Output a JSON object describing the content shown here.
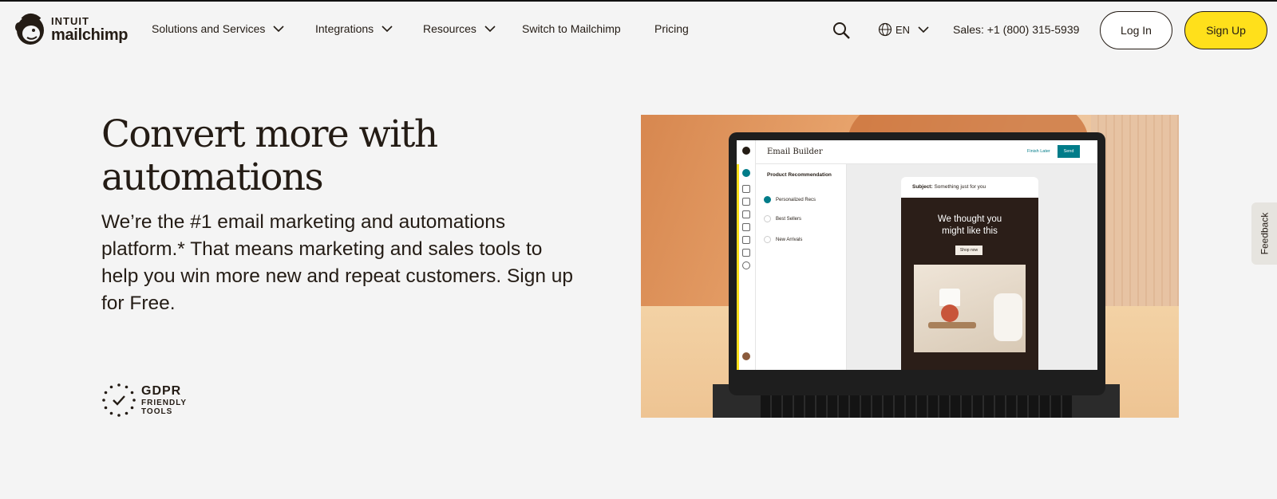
{
  "nav": {
    "logo": {
      "brand_top": "INTUIT",
      "brand_main": "mailchimp",
      "icon": "freddie-logo-icon"
    },
    "items": [
      {
        "label": "Solutions and Services",
        "has_dropdown": true
      },
      {
        "label": "Integrations",
        "has_dropdown": true
      },
      {
        "label": "Resources",
        "has_dropdown": true
      },
      {
        "label": "Switch to Mailchimp",
        "has_dropdown": false
      },
      {
        "label": "Pricing",
        "has_dropdown": false
      }
    ],
    "search_icon": "search-icon",
    "language": {
      "icon": "globe-icon",
      "label": "EN"
    },
    "sales": "Sales: +1 (800) 315-5939",
    "login_label": "Log In",
    "signup_label": "Sign Up"
  },
  "hero": {
    "title": "Convert more with automations",
    "subtitle": "We’re the #1 email marketing and automations platform.* That means marketing and sales tools to help you win more new and repeat customers. Sign up for Free.",
    "badge": {
      "line1": "GDPR",
      "line2": "FRIENDLY",
      "line3": "TOOLS"
    }
  },
  "mockup": {
    "app_title": "Email Builder",
    "finish_later": "Finish Later",
    "send": "Send",
    "panel_title": "Product Recommendation",
    "options": [
      "Personalized Recs",
      "Best Sellers",
      "New Arrivals"
    ],
    "subject_label": "Subject:",
    "subject_text": "Something just for you",
    "email_heading_1": "We thought you",
    "email_heading_2": "might like this",
    "shop_button": "Shop now"
  },
  "feedback": "Feedback",
  "colors": {
    "accent": "#ffe01b",
    "teal": "#007c89",
    "ink": "#241c15",
    "background": "#f4f4f4"
  }
}
